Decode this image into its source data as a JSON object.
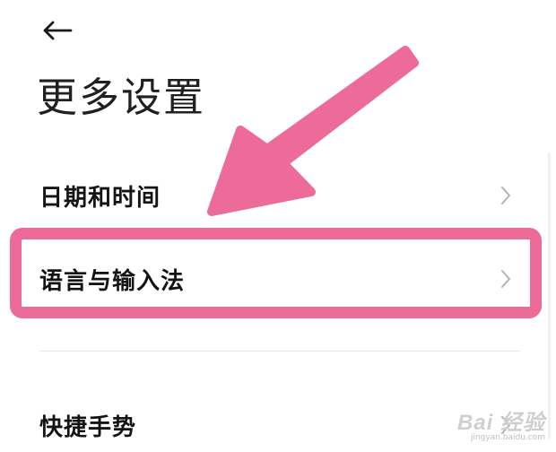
{
  "header": {
    "back_icon": "arrow-left-icon",
    "title": "更多设置"
  },
  "menu": {
    "items": [
      {
        "label": "日期和时间",
        "icon": "chevron-right-icon"
      },
      {
        "label": "语言与输入法",
        "icon": "chevron-right-icon"
      },
      {
        "label": "快捷手势",
        "icon": "chevron-right-icon"
      }
    ]
  },
  "annotation": {
    "arrow_color": "#ec6b98",
    "highlight_color": "#ec6b98",
    "highlighted_item": "语言与输入法"
  },
  "watermark": {
    "main": "Bai 经验",
    "sub": "jingyan.baidu.com"
  },
  "colors": {
    "background": "#ffffff",
    "text": "#141414",
    "chevron": "#b3b3b3",
    "divider": "#e6e6e6"
  }
}
